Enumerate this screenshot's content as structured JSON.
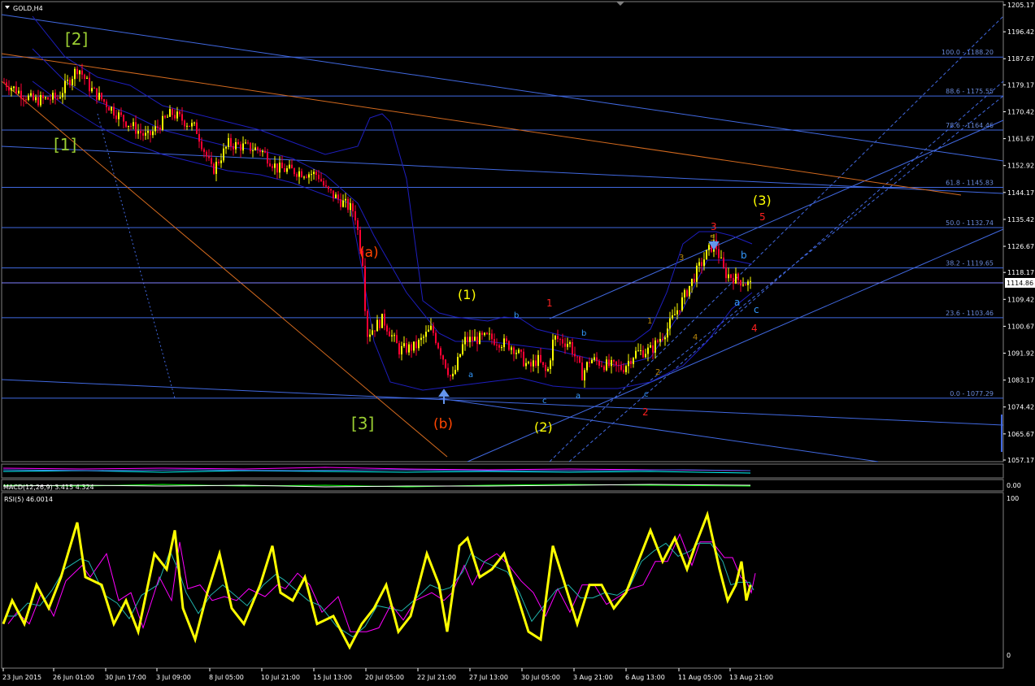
{
  "window": {
    "symbol_title": "GOLD,H4",
    "current_price": "1114.86"
  },
  "main_chart": {
    "price_axis": [
      "1205.17",
      "1196.42",
      "1187.67",
      "1179.17",
      "1170.42",
      "1161.67",
      "1152.92",
      "1144.17",
      "1135.42",
      "1126.67",
      "1118.17",
      "1109.42",
      "1100.67",
      "1091.92",
      "1083.17",
      "1074.42",
      "1065.67",
      "1057.17"
    ],
    "price_range": [
      1057.17,
      1205.17
    ],
    "fib_levels": [
      {
        "label": "100.0 - 1188.20",
        "price": 1188.2
      },
      {
        "label": "88.6 - 1175.55",
        "price": 1175.55
      },
      {
        "label": "78.6 - 1164.46",
        "price": 1164.46
      },
      {
        "label": "61.8 - 1145.83",
        "price": 1145.83
      },
      {
        "label": "50.0 - 1132.74",
        "price": 1132.74
      },
      {
        "label": "38.2 - 1119.65",
        "price": 1119.65
      },
      {
        "label": "23.6 - 1103.46",
        "price": 1103.46
      },
      {
        "label": "0.0 - 1077.29",
        "price": 1077.29
      }
    ],
    "wave_labels": [
      {
        "text": "[2]",
        "color": "#9acd32"
      },
      {
        "text": "[1]",
        "color": "#9acd32"
      },
      {
        "text": "[3]",
        "color": "#9acd32"
      },
      {
        "text": "(a)",
        "color": "#ff4500"
      },
      {
        "text": "(b)",
        "color": "#ff4500"
      },
      {
        "text": "(1)",
        "color": "#ffff00"
      },
      {
        "text": "(2)",
        "color": "#ffff00"
      },
      {
        "text": "(3)",
        "color": "#ffff00"
      },
      {
        "text": "1",
        "color": "#ff2020"
      },
      {
        "text": "2",
        "color": "#ff2020"
      },
      {
        "text": "3",
        "color": "#ff2020"
      },
      {
        "text": "4",
        "color": "#ff2020"
      },
      {
        "text": "5",
        "color": "#ff2020"
      },
      {
        "text": "a",
        "color": "#3399ff"
      },
      {
        "text": "b",
        "color": "#3399ff"
      },
      {
        "text": "c",
        "color": "#3399ff"
      },
      {
        "text": "a",
        "color": "#3399ff"
      },
      {
        "text": "b",
        "color": "#3399ff"
      },
      {
        "text": "c",
        "color": "#3399ff"
      },
      {
        "text": "1",
        "color": "#b8860b"
      },
      {
        "text": "2",
        "color": "#b8860b"
      },
      {
        "text": "3",
        "color": "#b8860b"
      },
      {
        "text": "4",
        "color": "#b8860b"
      },
      {
        "text": "5",
        "color": "#b8860b"
      },
      {
        "text": "a",
        "color": "#3399ff"
      },
      {
        "text": "b",
        "color": "#3399ff"
      },
      {
        "text": "c",
        "color": "#3399ff"
      }
    ]
  },
  "indicators": {
    "macd_label": "MACD(12,26,9) 3.415 4.324",
    "macd_axis": "0.00",
    "rsi_label": "RSI(5) 46.0014",
    "rsi_axis": [
      "100",
      "0"
    ]
  },
  "time_axis": [
    "23 Jun 2015",
    "26 Jun 01:00",
    "30 Jun 17:00",
    "3 Jul 09:00",
    "8 Jul 05:00",
    "10 Jul 21:00",
    "15 Jul 13:00",
    "20 Jul 05:00",
    "22 Jul 21:00",
    "27 Jul 13:00",
    "30 Jul 05:00",
    "3 Aug 21:00",
    "6 Aug 13:00",
    "11 Aug 05:00",
    "13 Aug 21:00"
  ],
  "colors": {
    "background": "#000000",
    "bull_candle": "#ffff00",
    "bear_candle": "#ff0033",
    "trendline": "#4169e1",
    "bollinger": "#1e1ebe",
    "orange_line": "#d2691e",
    "rsi_line": "#ffff00",
    "fib_text": "#6a8ad8"
  }
}
